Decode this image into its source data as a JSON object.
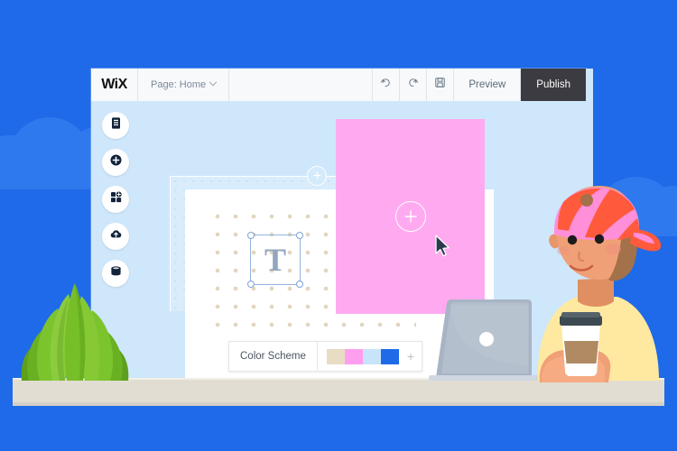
{
  "scene": {
    "background_color": "#1f6ae8",
    "description": "Wix website editor on a monitor with an illustrated person, laptop, plant and desk"
  },
  "window": {
    "titlebar": {
      "logo": "WiX",
      "page_selector": {
        "label": "Page: Home",
        "icon": "chevron-down-icon"
      },
      "actions": [
        {
          "name": "undo",
          "icon": "undo-arrow-icon",
          "label": ""
        },
        {
          "name": "redo",
          "icon": "redo-arrow-icon",
          "label": ""
        },
        {
          "name": "save",
          "icon": "save-floppy-icon",
          "label": ""
        }
      ],
      "preview_label": "Preview",
      "publish_label": "Publish",
      "publish_bg": "#3b3b41",
      "bar_bg": "#f7f9fb"
    },
    "canvas_bg": "#cfe7fb",
    "page_bg": "#ffffff"
  },
  "rail": {
    "items": [
      {
        "name": "pages-menu",
        "icon": "document-list-icon"
      },
      {
        "name": "add-element",
        "icon": "plus-circle-icon"
      },
      {
        "name": "add-app",
        "icon": "blocks-plus-icon"
      },
      {
        "name": "media-upload",
        "icon": "cloud-upload-icon"
      },
      {
        "name": "database",
        "icon": "database-stack-icon"
      }
    ]
  },
  "editor": {
    "section_frame": {
      "fill": "#d8ecfc",
      "add_badge": {
        "icon": "plus-icon",
        "label": "+"
      }
    },
    "text_element": {
      "glyph": "T",
      "selected": true,
      "handle_count": 4,
      "selection_color": "#93b5e0"
    },
    "pink_element": {
      "fill": "#ffaaf0",
      "placeholder_icon": "plus-icon",
      "placeholder_label": "+"
    },
    "cursor": {
      "icon": "mouse-pointer-icon"
    }
  },
  "color_panel": {
    "title": "Color Scheme",
    "swatches": [
      {
        "name": "swatch-beige",
        "hex": "#e8dcc4"
      },
      {
        "name": "swatch-pink",
        "hex": "#ff9eef"
      },
      {
        "name": "swatch-light-blue",
        "hex": "#c8e4fa"
      },
      {
        "name": "swatch-blue",
        "hex": "#1f6ae8"
      }
    ],
    "add_label": "+"
  },
  "illustration": {
    "desk": {
      "name": "desk-surface",
      "color": "#e2ddd3"
    },
    "plant": {
      "name": "agave-plant",
      "leaf_colors": [
        "#6ab023",
        "#7cc42e",
        "#8ccc3c",
        "#5ea01d"
      ]
    },
    "laptop": {
      "name": "laptop",
      "lid_color": "#a8b4c4",
      "logo": "circle"
    },
    "person": {
      "name": "person-with-coffee",
      "cap_colors": [
        "#ff5a3c",
        "#ff8fd8",
        "#ff9ecf"
      ],
      "shirt_color": "#ffe9a0",
      "skin_color": "#f0a077",
      "coffee_cup": {
        "lid": "#3e4a52",
        "sleeve": "#b08a63",
        "body": "#ffffff"
      }
    },
    "clouds": {
      "color": "#2f79ee",
      "count": 2
    }
  }
}
